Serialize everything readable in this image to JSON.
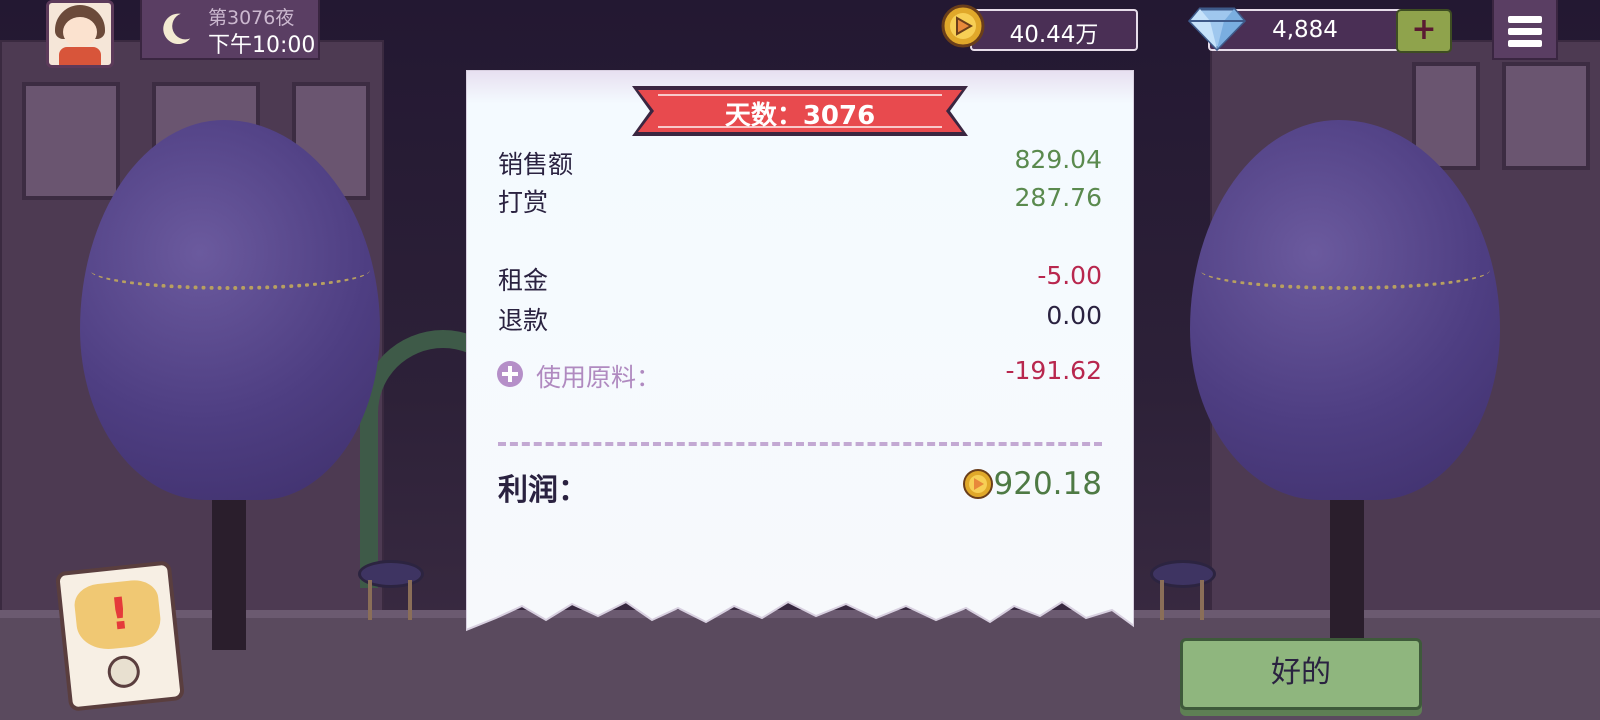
{
  "hud": {
    "day_label": "第3076夜",
    "time": "下午10:00",
    "coins": "40.44万",
    "gems": "4,884",
    "add_label": "+"
  },
  "receipt": {
    "title": "天数：3076",
    "rows": [
      {
        "label": "销售额",
        "value": "829.04"
      },
      {
        "label": "打赏",
        "value": "287.76"
      },
      {
        "label": "租金",
        "value": "-5.00"
      },
      {
        "label": "退款",
        "value": "0.00"
      }
    ],
    "ingredients_label": "使用原料：",
    "ingredients_value": "-191.62",
    "profit_label": "利润：",
    "profit_value": "920.18"
  },
  "ok_label": "好的",
  "colors": {
    "positive": "#5a8a4e",
    "negative": "#b8274e",
    "ribbon": "#e84a4e",
    "ok_button": "#8fb67e",
    "panel": "#5a3e63"
  },
  "icons": {
    "day": "moon-icon",
    "coin": "coin-icon",
    "gem": "diamond-icon",
    "menu": "hamburger-icon",
    "expand": "plus-circle-icon",
    "alert": "exclamation-icon"
  }
}
